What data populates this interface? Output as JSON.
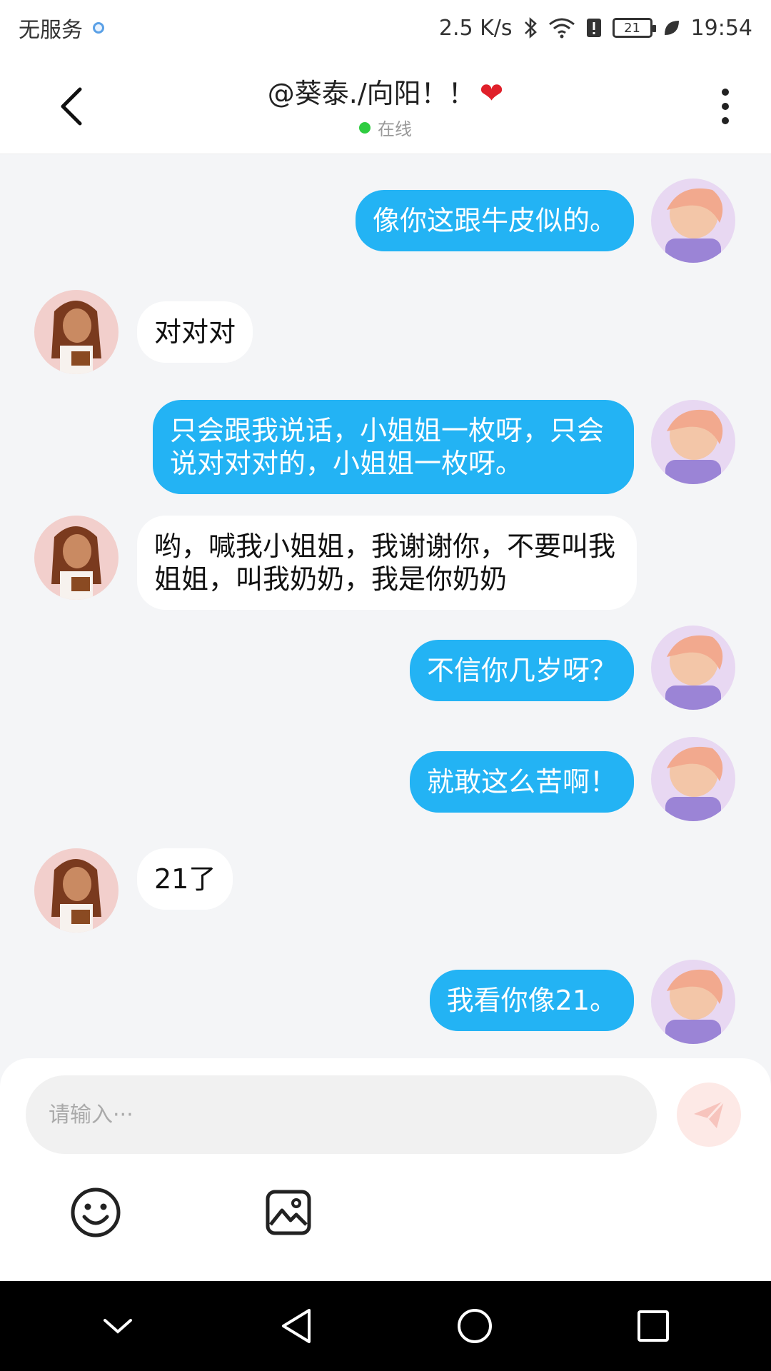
{
  "status_bar": {
    "carrier": "无服务",
    "net_speed": "2.5 K/s",
    "battery": "21",
    "time": "19:54"
  },
  "header": {
    "title": "@葵泰./向阳！！",
    "status": "在线"
  },
  "messages": [
    {
      "sender": "self",
      "text": "像你这跟牛皮似的。"
    },
    {
      "sender": "other",
      "text": "对对对"
    },
    {
      "sender": "self",
      "text": "只会跟我说话，小姐姐一枚呀，只会说对对对的，小姐姐一枚呀。"
    },
    {
      "sender": "other",
      "text": "哟，喊我小姐姐，我谢谢你，不要叫我姐姐，叫我奶奶，我是你奶奶"
    },
    {
      "sender": "self",
      "text": "不信你几岁呀？"
    },
    {
      "sender": "self",
      "text": "就敢这么苦啊！"
    },
    {
      "sender": "other",
      "text": "21了"
    },
    {
      "sender": "self",
      "text": "我看你像21。"
    }
  ],
  "composer": {
    "placeholder": "请输入···"
  },
  "colors": {
    "self_bubble": "#23b3f4",
    "other_bubble": "#ffffff",
    "online": "#2ecc40",
    "heart": "#e0202a"
  },
  "icons": {
    "back": "chevron-left-icon",
    "more": "more-vertical-icon",
    "send": "send-icon",
    "emoji": "smiley-icon",
    "image": "image-icon"
  }
}
